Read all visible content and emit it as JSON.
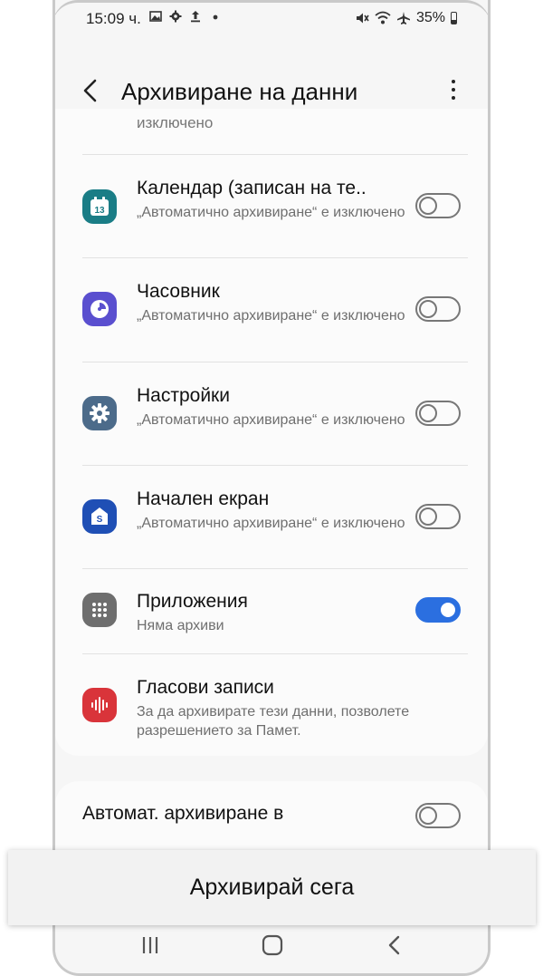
{
  "status_bar": {
    "time": "15:09 ч.",
    "battery": "35%",
    "icons_left": [
      "image-icon",
      "gear-icon",
      "upload-icon",
      "dot-icon"
    ],
    "icons_right": [
      "mute-icon",
      "wifi-icon",
      "airplane-icon",
      "battery-icon"
    ]
  },
  "header": {
    "title": "Архивиране на данни"
  },
  "list": {
    "cut_off_text": "изключено",
    "items": [
      {
        "icon": "calendar-icon",
        "icon_color": "#1a7d86",
        "icon_text": "13",
        "title": "Календар (записан на те..",
        "subtitle": "„Автоматично архивиране“ е изключено",
        "enabled": false
      },
      {
        "icon": "clock-icon",
        "icon_color": "#5a4fcf",
        "title": "Часовник",
        "subtitle": "„Автоматично архивиране“ е изключено",
        "enabled": false
      },
      {
        "icon": "settings-icon",
        "icon_color": "#4c6b8a",
        "title": "Настройки",
        "subtitle": "„Автоматично архивиране“ е изключено",
        "enabled": false
      },
      {
        "icon": "home-screen-icon",
        "icon_color": "#1f4fb5",
        "icon_text": "S",
        "title": "Начален екран",
        "subtitle": "„Автоматично архивиране“ е изключено",
        "enabled": false
      },
      {
        "icon": "apps-icon",
        "icon_color": "#6e6e6e",
        "title": "Приложения",
        "subtitle": "Няма архиви",
        "enabled": true
      },
      {
        "icon": "voice-recorder-icon",
        "icon_color": "#d9343a",
        "title": "Гласови записи",
        "subtitle": "За да архивирате тези данни, позволете разрешението за Памет."
      }
    ]
  },
  "auto_backup": {
    "label": "Автомат. архивиране в",
    "enabled": false
  },
  "action": {
    "backup_now": "Архивирай сега"
  },
  "colors": {
    "accent": "#2b6fe0",
    "background": "#f6f6f6",
    "card": "#fbfbfb"
  }
}
